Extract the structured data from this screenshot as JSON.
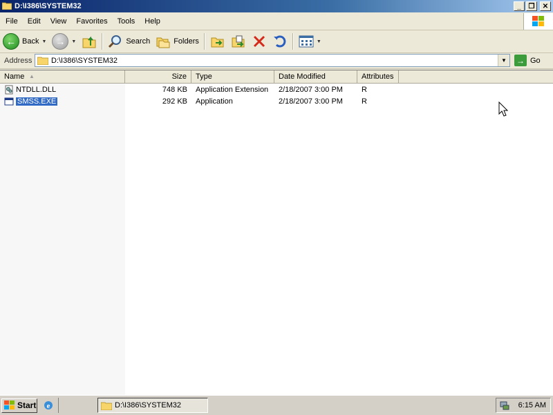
{
  "window": {
    "title": "D:\\I386\\SYSTEM32",
    "controls": [
      "minimize-icon",
      "restore-icon",
      "close-icon"
    ]
  },
  "menu": {
    "items": [
      "File",
      "Edit",
      "View",
      "Favorites",
      "Tools",
      "Help"
    ]
  },
  "toolbar": {
    "back_label": "Back",
    "search_label": "Search",
    "folders_label": "Folders"
  },
  "address": {
    "label": "Address",
    "value": "D:\\I386\\SYSTEM32",
    "go_label": "Go"
  },
  "list": {
    "columns": [
      "Name",
      "Size",
      "Type",
      "Date Modified",
      "Attributes"
    ],
    "rows": [
      {
        "name": "NTDLL.DLL",
        "size": "748 KB",
        "type": "Application Extension",
        "date": "2/18/2007 3:00 PM",
        "attributes": "R",
        "icon": "dll-file-icon",
        "selected": false
      },
      {
        "name": "SMSS.EXE",
        "size": "292 KB",
        "type": "Application",
        "date": "2/18/2007 3:00 PM",
        "attributes": "R",
        "icon": "exe-file-icon",
        "selected": true
      }
    ]
  },
  "taskbar": {
    "start_label": "Start",
    "task_label": "D:\\I386\\SYSTEM32",
    "clock": "6:15 AM"
  },
  "colors": {
    "title_gradient_start": "#0a246a",
    "selection": "#316ac5",
    "chrome": "#ece9d8"
  }
}
